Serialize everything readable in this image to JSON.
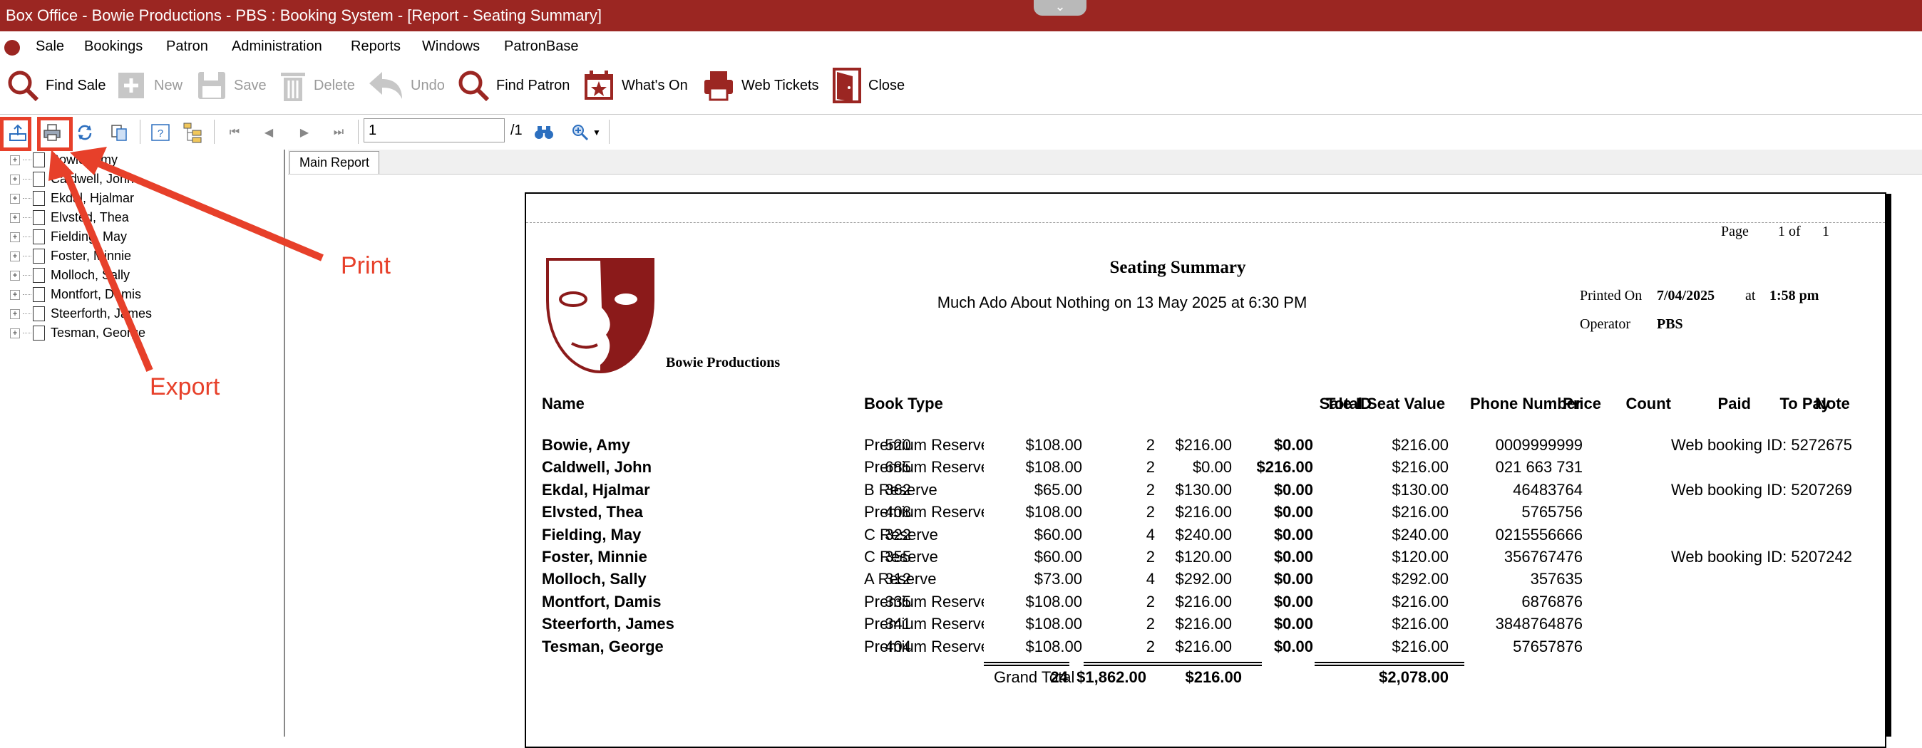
{
  "window": {
    "title": "Box Office - Bowie Productions - PBS : Booking System - [Report - Seating Summary]"
  },
  "menu": [
    "Sale",
    "Bookings",
    "Patron",
    "Administration",
    "Reports",
    "Windows",
    "PatronBase"
  ],
  "toolbar": {
    "find_sale": "Find Sale",
    "new": "New",
    "save": "Save",
    "delete": "Delete",
    "undo": "Undo",
    "find_patron": "Find Patron",
    "whats_on": "What's On",
    "web_tickets": "Web Tickets",
    "close": "Close"
  },
  "viewer": {
    "page_value": "1",
    "page_total": "/1"
  },
  "tree": [
    "Bowie, Amy",
    "Caldwell, John",
    "Ekdal, Hjalmar",
    "Elvsted, Thea",
    "Fielding, May",
    "Foster, Minnie",
    "Molloch, Sally",
    "Montfort, Damis",
    "Steerforth, James",
    "Tesman, George"
  ],
  "tabs": {
    "main": "Main Report"
  },
  "report": {
    "page_label": "Page",
    "page_num": "1 of",
    "page_total": "1",
    "title": "Seating Summary",
    "event": "Much Ado About Nothing on 13 May 2025 at 6:30 PM",
    "printed_on_label": "Printed On",
    "printed_on_date": "7/04/2025",
    "at_label": "at",
    "printed_time": "1:58 pm",
    "operator_label": "Operator",
    "operator": "PBS",
    "company": "Bowie Productions",
    "columns": [
      "Name",
      "Sale ID",
      "Book Type",
      "Price",
      "Count",
      "Paid",
      "To Pay",
      "Total Seat Value",
      "Phone Number",
      "Note"
    ],
    "rows": [
      [
        "Bowie, Amy",
        "520",
        "Premium Reserve",
        "$108.00",
        "2",
        "$216.00",
        "$0.00",
        "$216.00",
        "0009999999",
        "Web booking ID: 5272675"
      ],
      [
        "Caldwell, John",
        "685",
        "Premium Reserve",
        "$108.00",
        "2",
        "$0.00",
        "$216.00",
        "$216.00",
        "021 663 731",
        ""
      ],
      [
        "Ekdal, Hjalmar",
        "362",
        "B Reserve",
        "$65.00",
        "2",
        "$130.00",
        "$0.00",
        "$130.00",
        "46483764",
        "Web booking ID: 5207269"
      ],
      [
        "Elvsted, Thea",
        "408",
        "Premium Reserve",
        "$108.00",
        "2",
        "$216.00",
        "$0.00",
        "$216.00",
        "5765756",
        ""
      ],
      [
        "Fielding, May",
        "322",
        "C Reserve",
        "$60.00",
        "4",
        "$240.00",
        "$0.00",
        "$240.00",
        "0215556666",
        ""
      ],
      [
        "Foster, Minnie",
        "355",
        "C Reserve",
        "$60.00",
        "2",
        "$120.00",
        "$0.00",
        "$120.00",
        "356767476",
        "Web booking ID: 5207242"
      ],
      [
        "Molloch, Sally",
        "312",
        "A Reserve",
        "$73.00",
        "4",
        "$292.00",
        "$0.00",
        "$292.00",
        "357635",
        ""
      ],
      [
        "Montfort, Damis",
        "335",
        "Premium Reserve",
        "$108.00",
        "2",
        "$216.00",
        "$0.00",
        "$216.00",
        "6876876",
        ""
      ],
      [
        "Steerforth, James",
        "341",
        "Premium Reserve",
        "$108.00",
        "2",
        "$216.00",
        "$0.00",
        "$216.00",
        "3848764876",
        ""
      ],
      [
        "Tesman, George",
        "404",
        "Premium Reserve",
        "$108.00",
        "2",
        "$216.00",
        "$0.00",
        "$216.00",
        "57657876",
        ""
      ]
    ],
    "grand_total_label": "Grand Total",
    "totals": {
      "count": "24",
      "paid": "$1,862.00",
      "to_pay": "$216.00",
      "total": "$2,078.00"
    }
  },
  "annotations": {
    "print": "Print",
    "export": "Export"
  },
  "colors": {
    "brand": "#9b2622",
    "annotation": "#e7402a"
  }
}
